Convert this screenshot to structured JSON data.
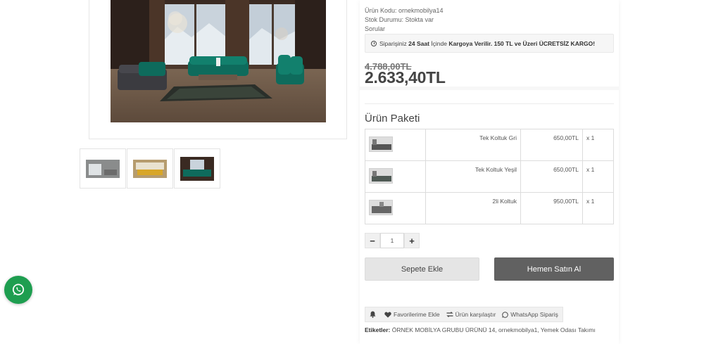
{
  "product": {
    "code_label": "Ürün Kodu: ornekmobilya14",
    "stock_label": "Stok Durumu: Stokta var",
    "questions_label": "Sorular",
    "old_price": "4.788,00TL",
    "price": "2.633,40TL"
  },
  "shipping_note": {
    "icon": "clock-icon",
    "prefix": "Siparişiniz",
    "bold1": "24 Saat",
    "middle": "İçinde",
    "bold2": "Kargoya Verilir. 150 TL ve Üzeri ÜCRETSİZ KARGO!"
  },
  "package": {
    "title": "Ürün Paketi",
    "items": [
      {
        "name": "Tek Koltuk Gri",
        "price": "650,00TL",
        "qty": "x 1"
      },
      {
        "name": "Tek Koltuk Yeşil",
        "price": "650,00TL",
        "qty": "x 1"
      },
      {
        "name": "2li Koltuk",
        "price": "950,00TL",
        "qty": "x 1"
      }
    ]
  },
  "quantity": {
    "value": "1",
    "minus": "−",
    "plus": "+"
  },
  "buttons": {
    "add_to_cart": "Sepete Ekle",
    "buy_now": "Hemen Satın Al"
  },
  "actions": {
    "notify_icon": "bell-icon",
    "favorites": "Favorilerime Ekle",
    "compare": "Ürün karşılaştır",
    "whatsapp_order": "WhatsApp Sipariş"
  },
  "tags": {
    "label": "Etiketler:",
    "value": "ÖRNEK MOBİLYA GRUBU ÜRÜNÜ 14, ornekmobilya1, Yemek Odası Takımı"
  },
  "colors": {
    "accent_dark": "#616161",
    "whatsapp_green": "#1e9e50",
    "teal_sofa": "#0e6b5c"
  }
}
